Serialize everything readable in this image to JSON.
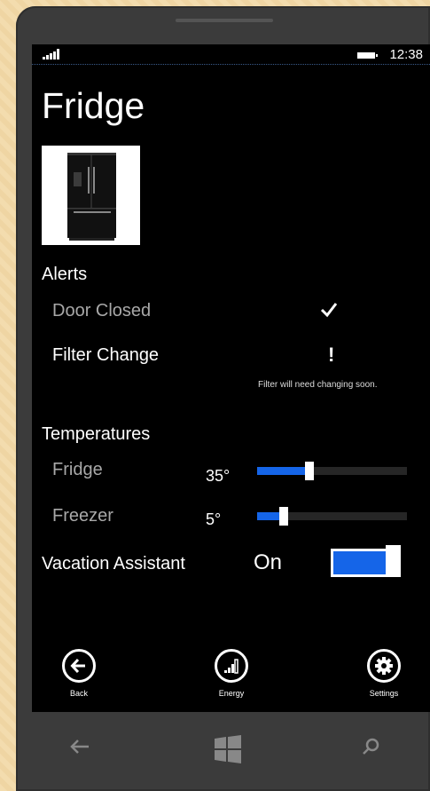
{
  "status_bar": {
    "time": "12:38",
    "signal_icon": "signal-icon",
    "battery_icon": "battery-icon"
  },
  "page": {
    "title": "Fridge",
    "image": "fridge-image"
  },
  "alerts": {
    "heading": "Alerts",
    "items": [
      {
        "label": "Door Closed",
        "status_icon": "checkmark-icon"
      },
      {
        "label": "Filter Change",
        "status_icon": "exclamation-icon",
        "status_text": "!",
        "note": "Filter will need changing soon."
      }
    ]
  },
  "temperatures": {
    "heading": "Temperatures",
    "items": [
      {
        "label": "Fridge",
        "value": "35°",
        "level_fraction": 0.35
      },
      {
        "label": "Freezer",
        "value": "5°",
        "level_fraction": 0.18
      }
    ]
  },
  "vacation": {
    "label": "Vacation Assistant",
    "state_label": "On",
    "enabled": true
  },
  "app_bar": {
    "buttons": [
      {
        "label": "Back",
        "icon": "back-arrow-icon"
      },
      {
        "label": "Energy",
        "icon": "energy-icon"
      },
      {
        "label": "Settings",
        "icon": "gear-icon"
      }
    ]
  },
  "nav_bar": {
    "back": "back-nav-icon",
    "start": "windows-start-icon",
    "search": "search-nav-icon"
  },
  "colors": {
    "accent": "#1565E8",
    "background": "#000000",
    "dim_text": "#A8A8A8"
  }
}
